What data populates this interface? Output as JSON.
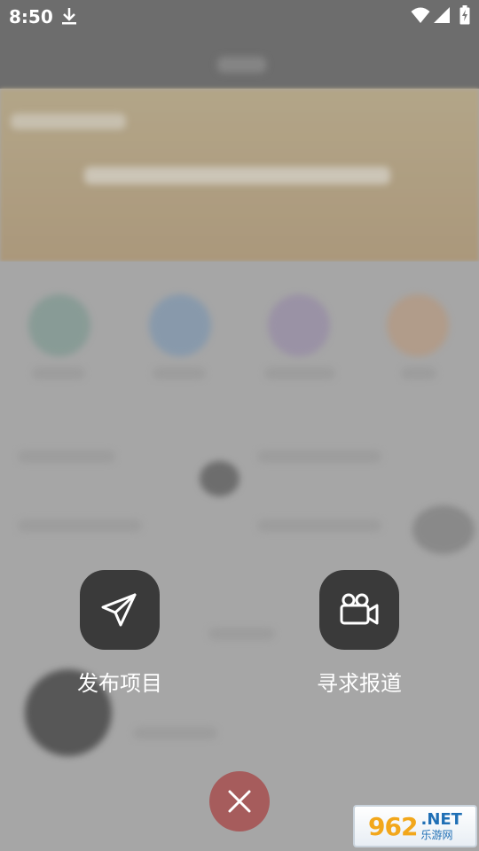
{
  "status_bar": {
    "time": "8:50",
    "icons": [
      "download-icon",
      "wifi-icon",
      "signal-icon",
      "battery-icon"
    ]
  },
  "actions": [
    {
      "label": "发布项目",
      "icon": "paper-plane-icon"
    },
    {
      "label": "寻求报道",
      "icon": "video-camera-icon"
    }
  ],
  "close": {
    "icon": "close-icon",
    "color": "#a65c5c"
  },
  "watermark": {
    "number": "962",
    "net": ".NET",
    "cn": "乐游网"
  },
  "colors": {
    "overlay": "#b7b7b7",
    "action_bg": "#3a3a3a",
    "label": "#ffffff"
  }
}
